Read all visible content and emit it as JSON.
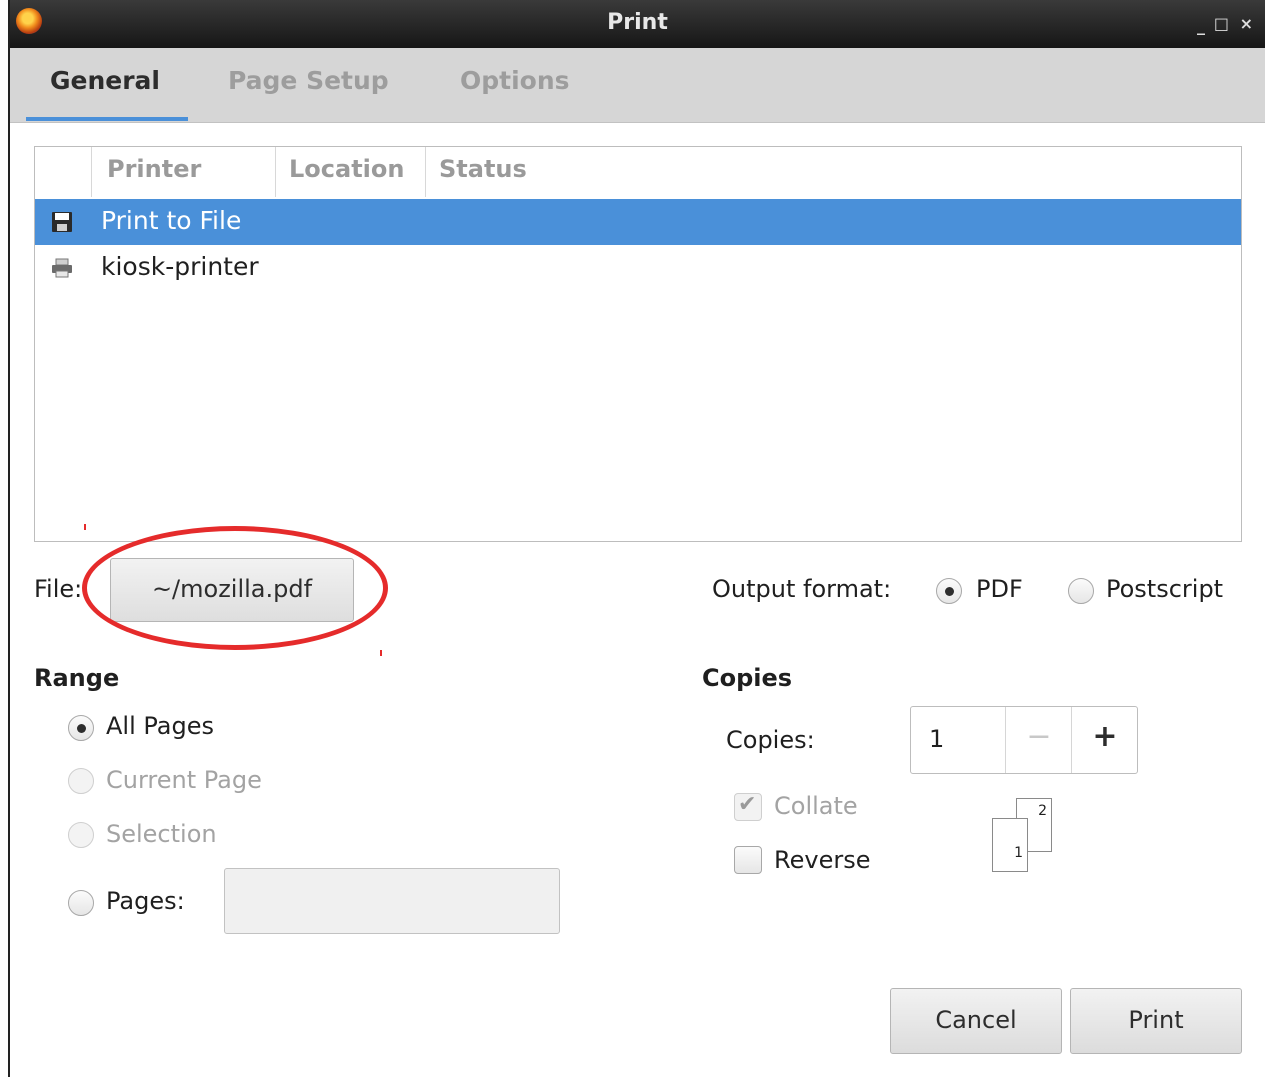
{
  "window": {
    "title": "Print",
    "controls": {
      "minimize": "_",
      "maximize": "□",
      "close": "×"
    }
  },
  "tabs": [
    "General",
    "Page Setup",
    "Options"
  ],
  "printer_table": {
    "columns": [
      "Printer",
      "Location",
      "Status"
    ],
    "rows": [
      {
        "name": "Print to File",
        "icon": "floppy-disk-icon",
        "selected": true
      },
      {
        "name": "kiosk-printer",
        "icon": "printer-icon",
        "selected": false
      }
    ]
  },
  "file": {
    "label": "File:",
    "value": "~/mozilla.pdf"
  },
  "output_format": {
    "label": "Output format:",
    "options": [
      "PDF",
      "Postscript"
    ],
    "selected": "PDF"
  },
  "range": {
    "title": "Range",
    "options": [
      "All Pages",
      "Current Page",
      "Selection",
      "Pages:"
    ],
    "selected": "All Pages",
    "pages_input": ""
  },
  "copies": {
    "title": "Copies",
    "label": "Copies:",
    "value": "1",
    "minus": "−",
    "plus": "+",
    "collate": {
      "label": "Collate",
      "checked": true,
      "disabled": true
    },
    "reverse": {
      "label": "Reverse",
      "checked": false
    },
    "illustration_pages": [
      "2",
      "1"
    ]
  },
  "buttons": {
    "cancel": "Cancel",
    "print": "Print"
  },
  "colors": {
    "accent": "#4a90d9",
    "annotation": "#e52b2b"
  }
}
